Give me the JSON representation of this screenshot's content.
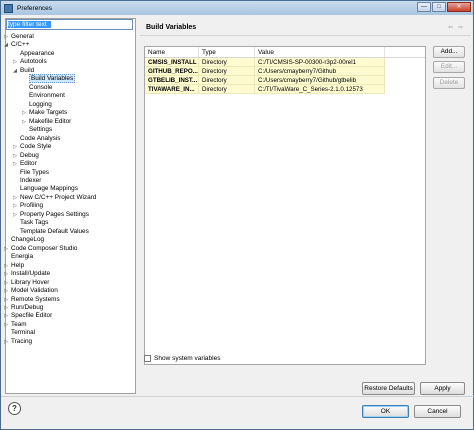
{
  "window": {
    "title": "Preferences"
  },
  "filter": {
    "value": "type filter text"
  },
  "tree": [
    {
      "label": "General",
      "level": 0,
      "tw": "▷"
    },
    {
      "label": "C/C++",
      "level": 0,
      "tw": "◢"
    },
    {
      "label": "Appearance",
      "level": 1,
      "tw": ""
    },
    {
      "label": "Autotools",
      "level": 1,
      "tw": "▷"
    },
    {
      "label": "Build",
      "level": 1,
      "tw": "◢"
    },
    {
      "label": "Build Variables",
      "level": 2,
      "tw": "",
      "selected": true
    },
    {
      "label": "Console",
      "level": 2,
      "tw": ""
    },
    {
      "label": "Environment",
      "level": 2,
      "tw": ""
    },
    {
      "label": "Logging",
      "level": 2,
      "tw": ""
    },
    {
      "label": "Make Targets",
      "level": 2,
      "tw": "▷"
    },
    {
      "label": "Makefile Editor",
      "level": 2,
      "tw": "▷"
    },
    {
      "label": "Settings",
      "level": 2,
      "tw": ""
    },
    {
      "label": "Code Analysis",
      "level": 1,
      "tw": ""
    },
    {
      "label": "Code Style",
      "level": 1,
      "tw": "▷"
    },
    {
      "label": "Debug",
      "level": 1,
      "tw": "▷"
    },
    {
      "label": "Editor",
      "level": 1,
      "tw": "▷"
    },
    {
      "label": "File Types",
      "level": 1,
      "tw": ""
    },
    {
      "label": "Indexer",
      "level": 1,
      "tw": ""
    },
    {
      "label": "Language Mappings",
      "level": 1,
      "tw": ""
    },
    {
      "label": "New C/C++ Project Wizard",
      "level": 1,
      "tw": "▷"
    },
    {
      "label": "Profiling",
      "level": 1,
      "tw": "▷"
    },
    {
      "label": "Property Pages Settings",
      "level": 1,
      "tw": "▷"
    },
    {
      "label": "Task Tags",
      "level": 1,
      "tw": ""
    },
    {
      "label": "Template Default Values",
      "level": 1,
      "tw": ""
    },
    {
      "label": "ChangeLog",
      "level": 0,
      "tw": ""
    },
    {
      "label": "Code Composer Studio",
      "level": 0,
      "tw": "▷"
    },
    {
      "label": "Energia",
      "level": 0,
      "tw": ""
    },
    {
      "label": "Help",
      "level": 0,
      "tw": "▷"
    },
    {
      "label": "Install/Update",
      "level": 0,
      "tw": "▷"
    },
    {
      "label": "Library Hover",
      "level": 0,
      "tw": "▷"
    },
    {
      "label": "Model Validation",
      "level": 0,
      "tw": "▷"
    },
    {
      "label": "Remote Systems",
      "level": 0,
      "tw": "▷"
    },
    {
      "label": "Run/Debug",
      "level": 0,
      "tw": "▷"
    },
    {
      "label": "Specfile Editor",
      "level": 0,
      "tw": "▷"
    },
    {
      "label": "Team",
      "level": 0,
      "tw": "▷"
    },
    {
      "label": "Terminal",
      "level": 0,
      "tw": ""
    },
    {
      "label": "Tracing",
      "level": 0,
      "tw": "▷"
    }
  ],
  "page": {
    "title": "Build Variables"
  },
  "table": {
    "headers": [
      "Name",
      "Type",
      "Value"
    ],
    "rows": [
      [
        "CMSIS_INSTALL",
        "Directory",
        "C:/TI/CMSIS-SP-00300-r3p2-00rel1"
      ],
      [
        "GITHUB_REPO...",
        "Directory",
        "C:/Users/cmayberry7/Github"
      ],
      [
        "GTBELIB_INST...",
        "Directory",
        "C:/Users/cmayberry7/Github/gtbelib"
      ],
      [
        "TIVAWARE_IN...",
        "Directory",
        "C:/TI/TivaWare_C_Series-2.1.0.12573"
      ]
    ]
  },
  "buttons": {
    "add": "Add...",
    "edit": "Edit...",
    "delete": "Delete",
    "restore": "Restore Defaults",
    "apply": "Apply",
    "ok": "OK",
    "cancel": "Cancel"
  },
  "checkbox": {
    "label": "Show system variables",
    "checked": false
  },
  "icons": {
    "help": "?",
    "back": "⇦",
    "forward": "⇨",
    "minimize": "—",
    "maximize": "□",
    "close": "✕"
  }
}
